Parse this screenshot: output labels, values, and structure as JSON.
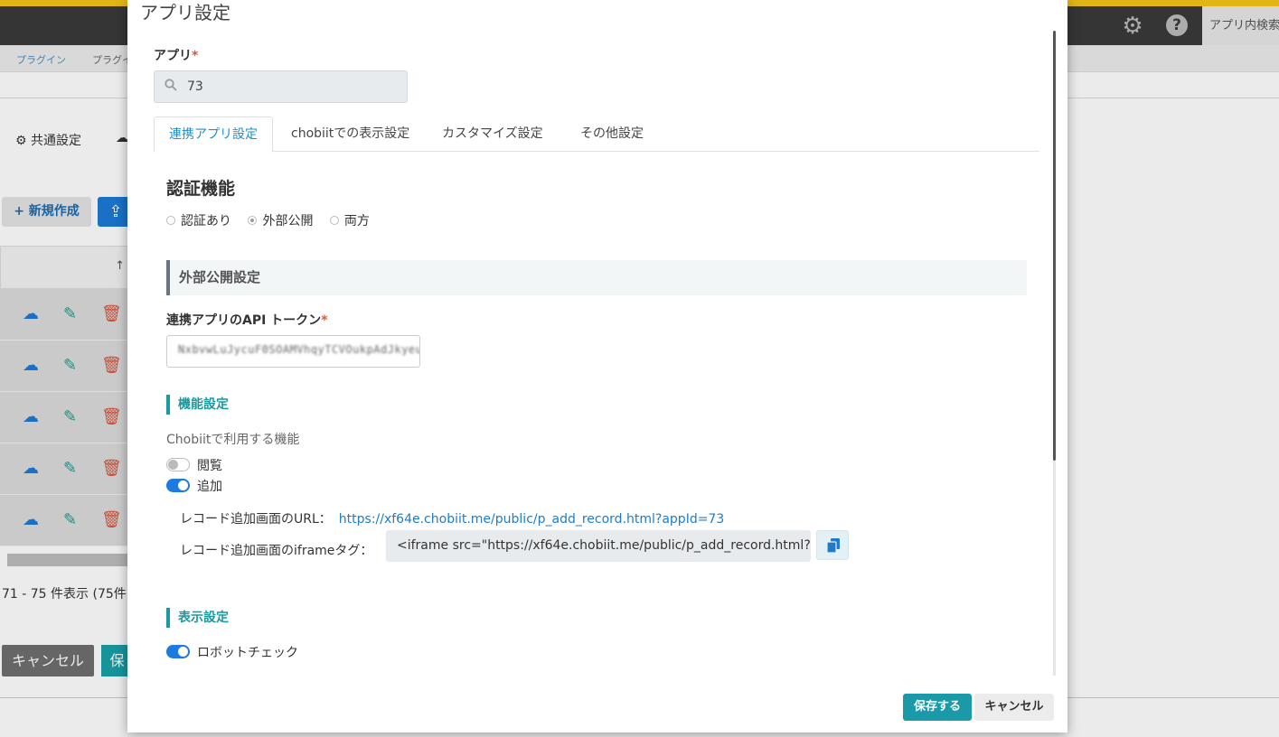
{
  "background": {
    "topbar": {
      "search_label": "アプリ内検索",
      "gear_icon": "gear-icon",
      "help_icon": "question-circle-icon"
    },
    "breadcrumb": [
      "プラグイン",
      "プラグイ"
    ],
    "tabs": [
      "共通設定"
    ],
    "new_button": "+ 新規作成",
    "table_header": "↑",
    "row_count": 5,
    "pagination_text": "71 - 75 件表示 (75件中",
    "cancel_button": "キャンセル",
    "save_button_partial": "保"
  },
  "modal": {
    "title": "アプリ設定",
    "app_label": "アプリ",
    "required_mark": "*",
    "app_search_value": "73",
    "tabs": [
      {
        "label": "連携アプリ設定",
        "active": true
      },
      {
        "label": "chobiitでの表示設定",
        "active": false
      },
      {
        "label": "カスタマイズ設定",
        "active": false
      },
      {
        "label": "その他設定",
        "active": false
      }
    ],
    "auth": {
      "heading": "認証機能",
      "options": [
        {
          "label": "認証あり",
          "checked": false
        },
        {
          "label": "外部公開",
          "checked": true
        },
        {
          "label": "両方",
          "checked": false
        }
      ]
    },
    "public_settings": {
      "heading": "外部公開設定",
      "token_label": "連携アプリのAPI トークン",
      "token_value": "NxbvwLuJycuF0SOAMVhqyTCVOukpAdJkyeu2"
    },
    "feature_settings": {
      "heading": "機能設定",
      "description": "Chobiitで利用する機能",
      "toggles": [
        {
          "label": "閲覧",
          "on": false
        },
        {
          "label": "追加",
          "on": true
        }
      ],
      "url_label": "レコード追加画面のURL：",
      "url_value": "https://xf64e.chobiit.me/public/p_add_record.html?appId=73",
      "iframe_label": "レコード追加画面のiframeタグ：",
      "iframe_value": "<iframe src=\"https://xf64e.chobiit.me/public/p_add_record.html?ap"
    },
    "display_settings": {
      "heading": "表示設定",
      "toggles": [
        {
          "label": "ロボットチェック",
          "on": true
        }
      ]
    },
    "footer": {
      "save_label": "保存する",
      "cancel_label": "キャンセル"
    }
  },
  "colors": {
    "accent_teal": "#1a9aa8",
    "link_blue": "#1e7cc8",
    "toggle_on": "#1c7ae0",
    "topbar_yellow": "#f5c518"
  }
}
